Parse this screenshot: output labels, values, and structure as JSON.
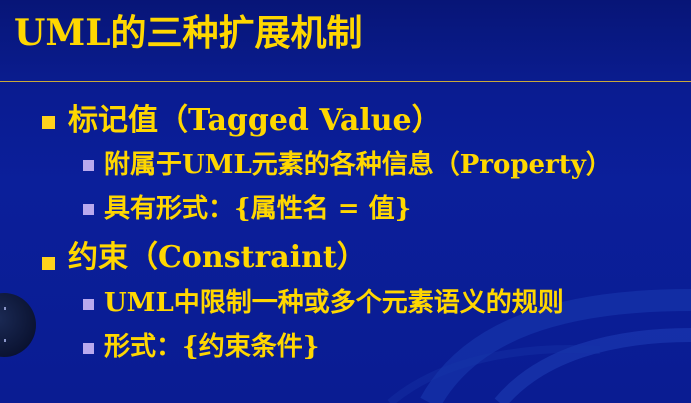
{
  "slide": {
    "title": "UML的三种扩展机制",
    "items": [
      {
        "level": 1,
        "text": "标记值（Tagged Value）"
      },
      {
        "level": 2,
        "text": "附属于UML元素的各种信息（Property）"
      },
      {
        "level": 2,
        "text": "具有形式：{属性名 = 值}"
      },
      {
        "level": 1,
        "text": "约束（Constraint）"
      },
      {
        "level": 2,
        "text": "UML中限制一种或多个元素语义的规则"
      },
      {
        "level": 2,
        "text": "形式：{约束条件}"
      }
    ]
  },
  "colors": {
    "background": "#0a1c92",
    "title_text": "#ffd700",
    "body_text": "#ffd700",
    "bullet_level1": "#ffd21c",
    "bullet_level2": "#b9a9ee",
    "rule": "#c9a83a"
  }
}
